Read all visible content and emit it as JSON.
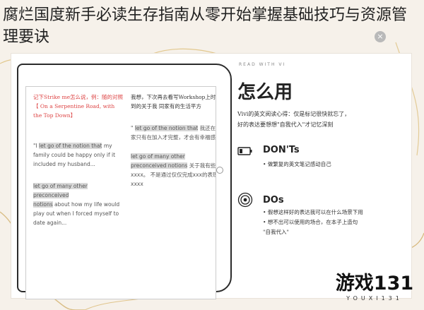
{
  "page": {
    "title": "腐烂国度新手必读生存指南从零开始掌握基础技巧与资源管理要诀"
  },
  "tablet": {
    "left_col": {
      "note_red": "记下Strike me怎么说，例：随的对照【 On a Serpentine Road, with the Top Down】",
      "para1_before": "\"I ",
      "para1_hl": "let go of the notion that",
      "para1_after": " my family could be happy only if it included my husband...",
      "para2_hl1": "let go of many other preconceived",
      "para2_hl2": "notions",
      "para2_after": " about how my life would play out when I forced myself to date again..."
    },
    "right_col": {
      "note_black": "我想，下次再去看写Workshop上时用到的关于我 同家有的生活平方",
      "para1_before": "\" ",
      "para1_hl": "let go of the notion that",
      "para1_after": " 我还在想家只有在加入才完整，才会有幸福感",
      "para2_before": "",
      "para2_hl": "let go of many other preconceived notions",
      "para2_after": " 关于我有些不xxxx。 不是通过仅仅完成xxx的表现xxxx"
    }
  },
  "panel": {
    "read_with": "READ WITH VI",
    "howto": "怎么用",
    "intro_line1": "Vivi的英文阅读心得：仅是标记很快就忘了，",
    "intro_line2": "好的表达要想想\"自我代入\"才记忆深刻",
    "donts": {
      "title": "DON'Ts",
      "items": [
        "•  做繁复的英文笔记感动自己"
      ]
    },
    "dos": {
      "title": "DOs",
      "items": [
        "•  假想这样好的表达我可以在什么场景下用",
        "•  想不出可以使用的场合，在本子上造句",
        "   \"自我代入\""
      ]
    }
  },
  "logo": {
    "main": "游戏131",
    "sub": "YOUXI131"
  },
  "close": {
    "glyph": "×"
  },
  "colors": {
    "accent": "#d4a94a",
    "card": "#ffffff"
  }
}
